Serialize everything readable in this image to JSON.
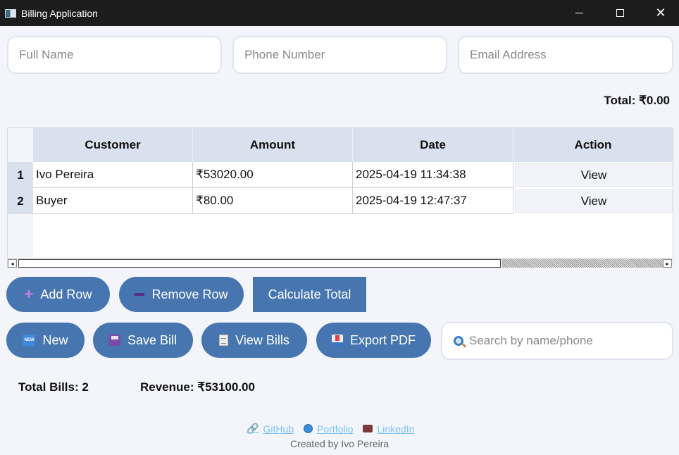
{
  "window": {
    "title": "Billing Application"
  },
  "form": {
    "name_placeholder": "Full Name",
    "phone_placeholder": "Phone Number",
    "email_placeholder": "Email Address"
  },
  "total_label": "Total: ₹0.00",
  "table": {
    "columns": [
      "Customer",
      "Amount",
      "Date",
      "Action"
    ],
    "rows": [
      {
        "num": "1",
        "customer": "Ivo Pereira",
        "amount": "₹53020.00",
        "date": "2025-04-19 11:34:38",
        "action": "View"
      },
      {
        "num": "2",
        "customer": "Buyer",
        "amount": "₹80.00",
        "date": "2025-04-19 12:47:37",
        "action": "View"
      }
    ]
  },
  "buttons": {
    "add_row": "Add Row",
    "remove_row": "Remove Row",
    "calculate_total": "Calculate Total",
    "new": "New",
    "save_bill": "Save Bill",
    "view_bills": "View Bills",
    "export_pdf": "Export PDF"
  },
  "search": {
    "placeholder": "Search by name/phone"
  },
  "stats": {
    "total_bills": "Total Bills: 2",
    "revenue": "Revenue: ₹53100.00"
  },
  "footer": {
    "github": "GitHub",
    "portfolio": "Portfolio",
    "linkedin": "LinkedIn",
    "credit": "Created by Ivo Pereira"
  },
  "colors": {
    "accent": "#4675b0",
    "header_bg": "#d9e1ef",
    "titlebar": "#1c1c1c"
  }
}
